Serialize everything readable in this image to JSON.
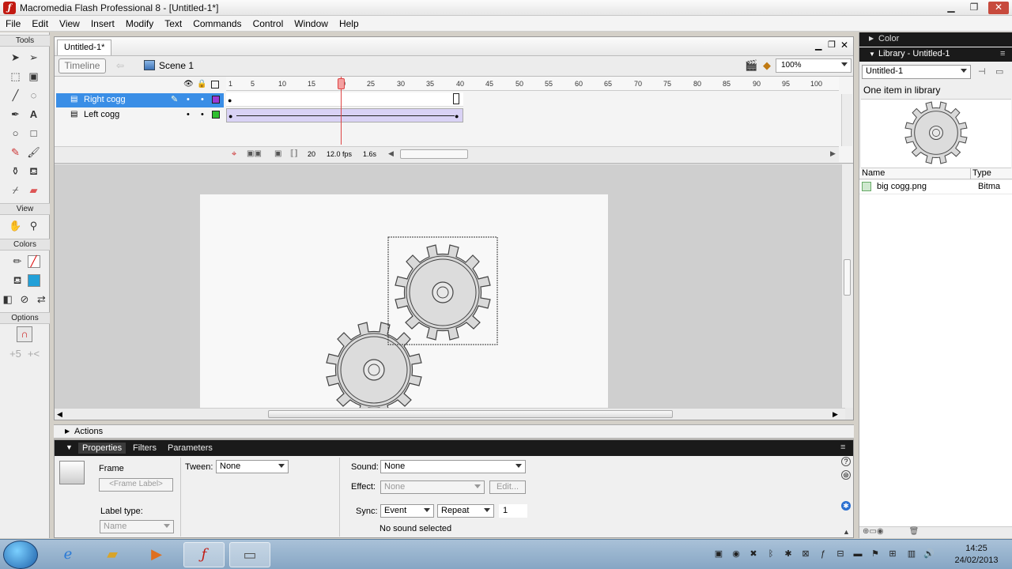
{
  "window": {
    "title": "Macromedia Flash Professional 8 - [Untitled-1*]",
    "app_icon": "flash-icon"
  },
  "menu": [
    "File",
    "Edit",
    "View",
    "Insert",
    "Modify",
    "Text",
    "Commands",
    "Control",
    "Window",
    "Help"
  ],
  "tools": {
    "header": "Tools",
    "view_header": "View",
    "colors_header": "Colors",
    "options_header": "Options"
  },
  "document": {
    "tab": "Untitled-1*",
    "timeline_button": "Timeline",
    "scene": "Scene 1",
    "zoom": "100%"
  },
  "timeline": {
    "layers": [
      {
        "name": "Right cogg",
        "selected": true,
        "color": "#9a3ad6"
      },
      {
        "name": "Left cogg",
        "selected": false,
        "color": "#2fbf2f"
      }
    ],
    "ruler_ticks": [
      "1",
      "5",
      "10",
      "15",
      "20",
      "25",
      "30",
      "35",
      "40",
      "45",
      "50",
      "55",
      "60",
      "65",
      "70",
      "75",
      "80",
      "85",
      "90",
      "95",
      "100"
    ],
    "current_frame": "20",
    "fps": "12.0 fps",
    "time": "1.6s"
  },
  "actions_panel": {
    "label": "Actions"
  },
  "properties": {
    "tabs": [
      "Properties",
      "Filters",
      "Parameters"
    ],
    "type_label": "Frame",
    "frame_label_placeholder": "<Frame Label>",
    "tween_label": "Tween:",
    "tween_value": "None",
    "label_type_label": "Label type:",
    "label_type_value": "Name",
    "sound_label": "Sound:",
    "sound_value": "None",
    "effect_label": "Effect:",
    "effect_value": "None",
    "edit_button": "Edit...",
    "sync_label": "Sync:",
    "sync_value": "Event",
    "repeat_value": "Repeat",
    "repeat_count": "1",
    "no_sound": "No sound selected"
  },
  "color_panel": {
    "title": "Color"
  },
  "library": {
    "title": "Library - Untitled-1",
    "selector": "Untitled-1",
    "count": "One item in library",
    "col_name": "Name",
    "col_type": "Type",
    "item_name": "big cogg.png",
    "item_type": "Bitma"
  },
  "taskbar": {
    "time": "14:25",
    "date": "24/02/2013"
  },
  "colors": {
    "selection": "#3a8ee6",
    "flash_red": "#c21a12"
  }
}
